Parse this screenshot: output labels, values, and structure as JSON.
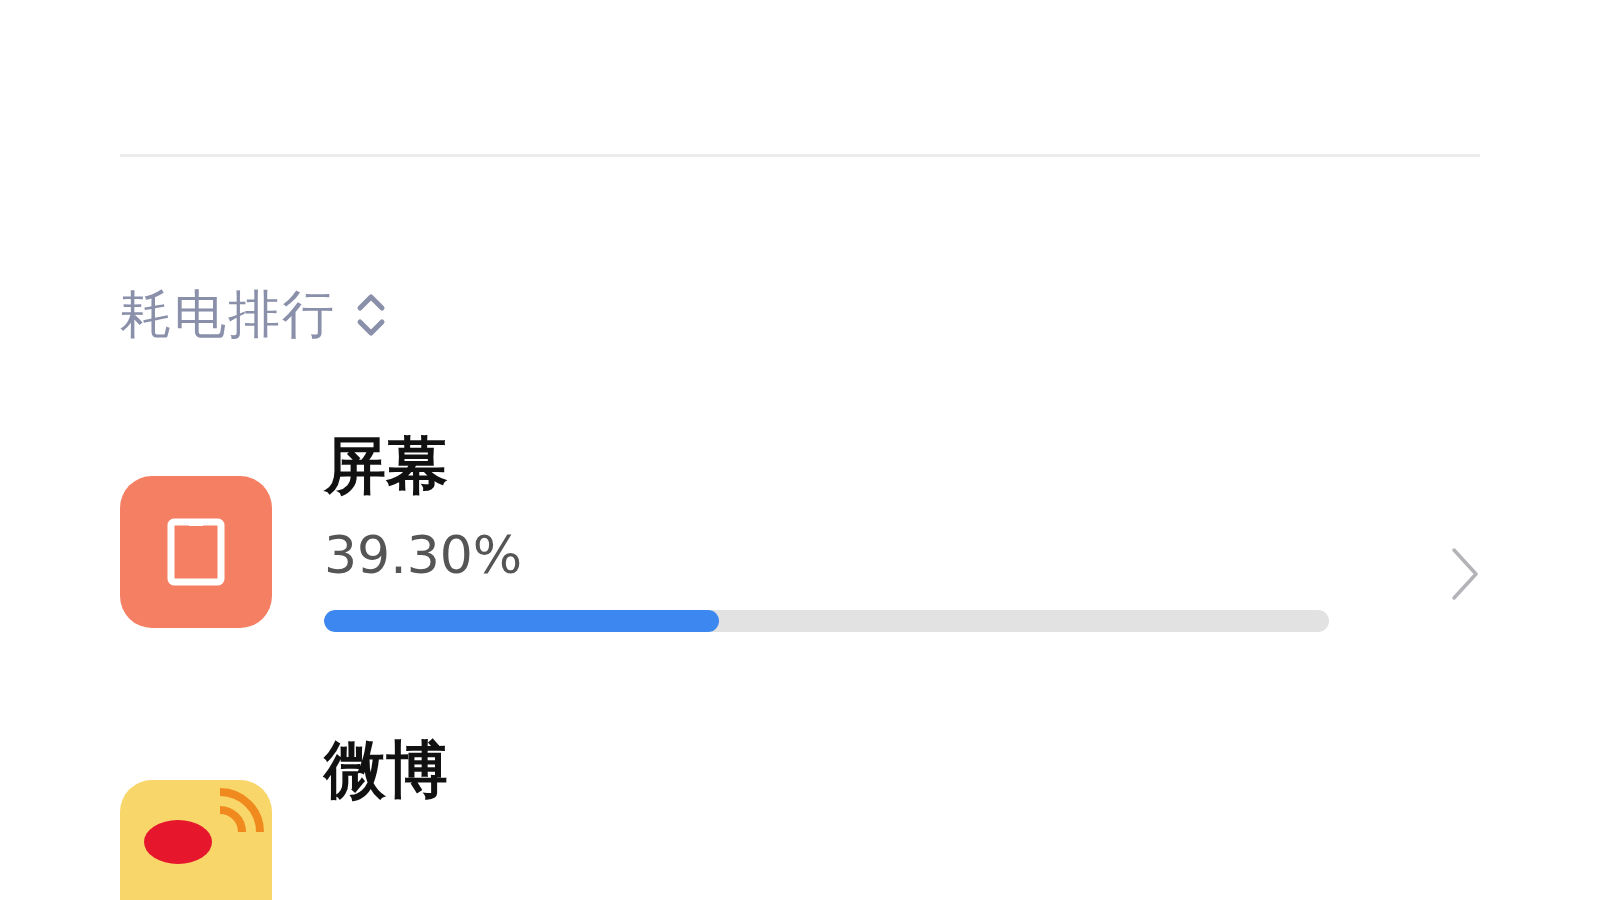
{
  "section_header": {
    "label": "耗电排行"
  },
  "items": [
    {
      "kind": "screen",
      "name": "屏幕",
      "percent": "39.30%",
      "level": 0.393
    },
    {
      "kind": "weibo",
      "name": "微博"
    }
  ]
}
